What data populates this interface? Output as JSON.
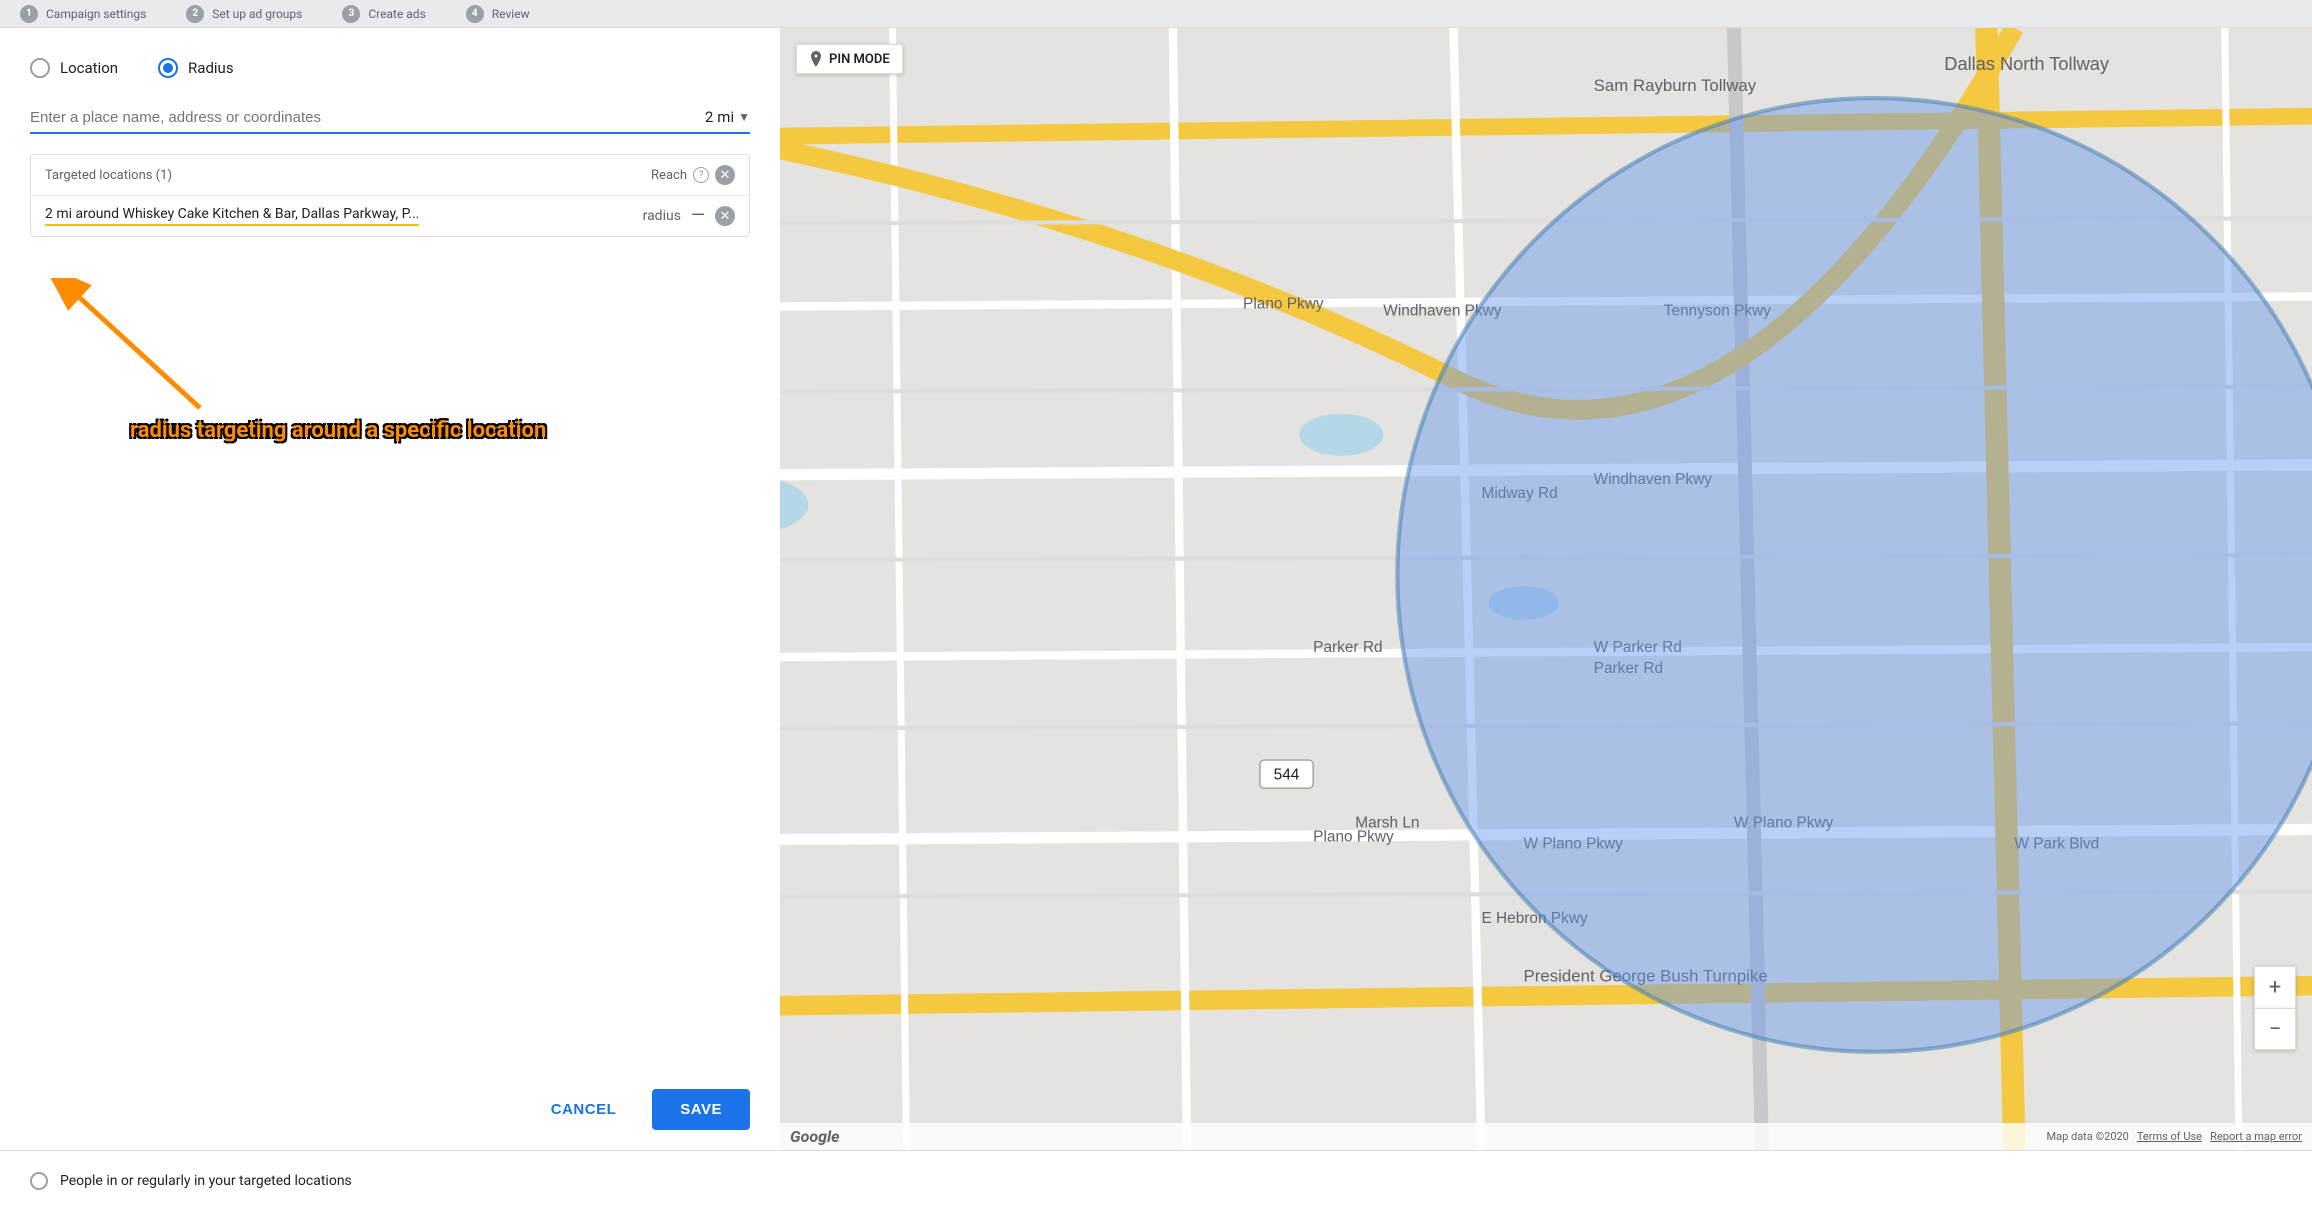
{
  "nav": {
    "steps": [
      {
        "label": "Campaign settings",
        "num": "1",
        "active": false
      },
      {
        "label": "Set up ad groups",
        "num": "2",
        "active": false
      },
      {
        "label": "Create ads",
        "num": "3",
        "active": false
      },
      {
        "label": "Review",
        "num": "4",
        "active": false
      }
    ]
  },
  "dialog": {
    "radio_location_label": "Location",
    "radio_radius_label": "Radius",
    "search_placeholder": "Enter a place name, address or coordinates",
    "radius_value": "2",
    "radius_unit": "mi",
    "targeted_title": "Targeted locations (1)",
    "reach_label": "Reach",
    "targeted_entry": "2 mi around Whiskey Cake Kitchen & Bar, Dallas Parkway, P...",
    "radius_tag": "radius",
    "cancel_label": "CANCEL",
    "save_label": "SAVE"
  },
  "annotation": {
    "text": "radius targeting around a specific location"
  },
  "map": {
    "pin_mode_label": "PIN MODE",
    "zoom_in": "+",
    "zoom_out": "−",
    "footer_data": "Map data ©2020",
    "footer_terms": "Terms of Use",
    "footer_report": "Report a map error"
  },
  "bottom_bar": {
    "text": "People in or regularly in your targeted locations"
  }
}
